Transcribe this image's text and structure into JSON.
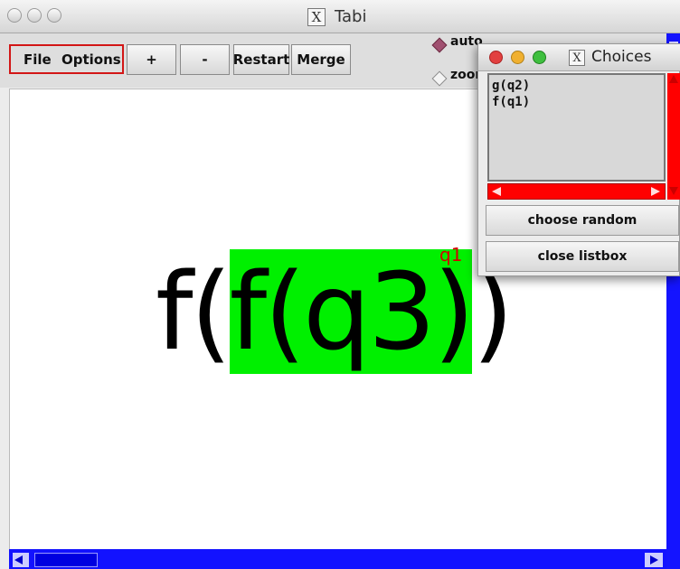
{
  "window": {
    "title": "Tabi",
    "x_glyph": "X"
  },
  "toolbar": {
    "menu_file": "File",
    "menu_options": "Options",
    "plus_label": "+",
    "minus_label": "-",
    "restart_label": "Restart",
    "merge_label": "Merge",
    "radio_auto_label": "auto",
    "radio_zoom_label": "zoom"
  },
  "canvas": {
    "expr_prefix": "f(",
    "expr_highlight": "f(q3)",
    "expr_suffix": ")",
    "highlight_tag": "q1"
  },
  "choices_window": {
    "title": "Choices",
    "x_glyph": "X",
    "items": [
      "g(q2)",
      "f(q1)"
    ],
    "choose_random_label": "choose random",
    "close_listbox_label": "close listbox"
  },
  "colors": {
    "highlight": "#00f000",
    "tag": "#d40000",
    "scrollbar_blue": "#1212ff",
    "listbox_scroll_red": "#ff0000"
  }
}
